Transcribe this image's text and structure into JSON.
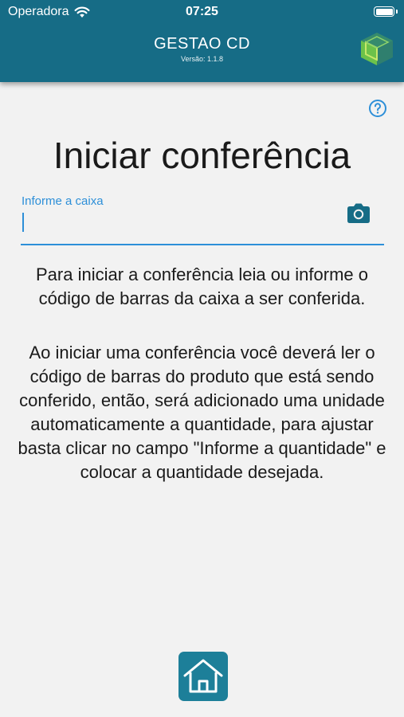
{
  "status_bar": {
    "carrier": "Operadora",
    "time": "07:25",
    "battery_level": 1.0
  },
  "header": {
    "title": "GESTAO CD",
    "version": "Versão: 1.1.8",
    "logo_icon": "cube-logo-icon",
    "background": "#166c86"
  },
  "help": {
    "icon": "question-circle-icon"
  },
  "main": {
    "title": "Iniciar conferência",
    "field": {
      "label": "Informe a caixa",
      "value": "",
      "placeholder": ""
    },
    "camera_icon": "camera-icon",
    "paragraph1": "Para iniciar a conferência leia ou informe o código de barras da caixa a ser conferida.",
    "paragraph2": "Ao iniciar uma conferência você deverá ler o código de barras do produto que está sendo conferido, então, será adicionado uma unidade automaticamente a quantidade, para ajustar basta clicar no campo \"Informe a quantidade\" e colocar a quantidade desejada."
  },
  "footer": {
    "home_icon": "home-icon"
  },
  "colors": {
    "accent": "#2d8fd8",
    "primary": "#166c86",
    "home_button": "#1d7f99"
  }
}
